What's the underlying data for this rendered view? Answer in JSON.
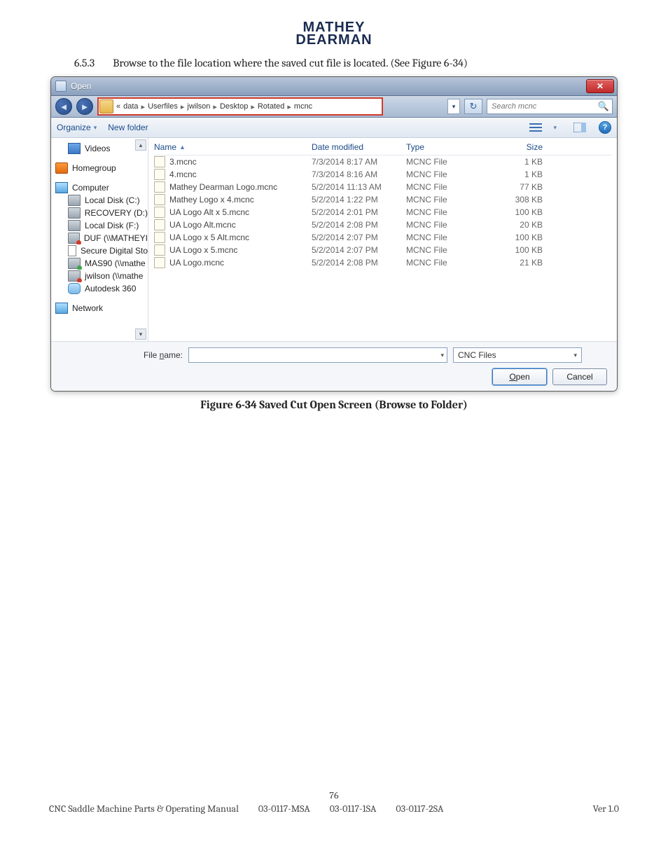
{
  "brand": {
    "line1": "MATHEY",
    "line2": "DEARMAN"
  },
  "instruction": {
    "num": "6.5.3",
    "text": "Browse to the file location where the saved cut file is located. (See Figure 6-34)"
  },
  "dialog": {
    "title": "Open",
    "close_glyph": "✕",
    "nav": {
      "back_glyph": "◄",
      "fwd_glyph": "►",
      "history_glyph": "▾",
      "refresh_glyph": "↻",
      "breadcrumb_prefix": "«",
      "breadcrumb": [
        "data",
        "Userfiles",
        "jwilson",
        "Desktop",
        "Rotated",
        "mcnc"
      ],
      "search_placeholder": "Search mcnc",
      "search_glyph": "🔍"
    },
    "toolbar": {
      "organize": "Organize",
      "newfolder": "New folder",
      "dd_glyph": "▾",
      "help_glyph": "?"
    },
    "navpane": {
      "videos": "Videos",
      "homegroup": "Homegroup",
      "computer": "Computer",
      "drives": [
        {
          "label": "Local Disk (C:)",
          "icon": "ic-drive"
        },
        {
          "label": "RECOVERY (D:)",
          "icon": "ic-drive"
        },
        {
          "label": "Local Disk (F:)",
          "icon": "ic-drive"
        },
        {
          "label": "DUF (\\\\MATHEYI",
          "icon": "ic-netdr dis"
        },
        {
          "label": "Secure Digital Sto",
          "icon": "ic-card"
        },
        {
          "label": "MAS90 (\\\\mathe",
          "icon": "ic-netdr"
        },
        {
          "label": "jwilson (\\\\mathe",
          "icon": "ic-netdr dis"
        },
        {
          "label": "Autodesk 360",
          "icon": "ic-cloud"
        }
      ],
      "network": "Network"
    },
    "columns": {
      "name": "Name",
      "date": "Date modified",
      "type": "Type",
      "size": "Size",
      "sort_glyph": "▲"
    },
    "files": [
      {
        "name": "3.mcnc",
        "date": "7/3/2014 8:17 AM",
        "type": "MCNC File",
        "size": "1 KB"
      },
      {
        "name": "4.mcnc",
        "date": "7/3/2014 8:16 AM",
        "type": "MCNC File",
        "size": "1 KB"
      },
      {
        "name": "Mathey Dearman Logo.mcnc",
        "date": "5/2/2014 11:13 AM",
        "type": "MCNC File",
        "size": "77 KB"
      },
      {
        "name": "Mathey Logo x 4.mcnc",
        "date": "5/2/2014 1:22 PM",
        "type": "MCNC File",
        "size": "308 KB"
      },
      {
        "name": "UA Logo Alt x 5.mcnc",
        "date": "5/2/2014 2:01 PM",
        "type": "MCNC File",
        "size": "100 KB"
      },
      {
        "name": "UA Logo Alt.mcnc",
        "date": "5/2/2014 2:08 PM",
        "type": "MCNC File",
        "size": "20 KB"
      },
      {
        "name": "UA Logo x 5 Alt.mcnc",
        "date": "5/2/2014 2:07 PM",
        "type": "MCNC File",
        "size": "100 KB"
      },
      {
        "name": "UA Logo x 5.mcnc",
        "date": "5/2/2014 2:07 PM",
        "type": "MCNC File",
        "size": "100 KB"
      },
      {
        "name": "UA Logo.mcnc",
        "date": "5/2/2014 2:08 PM",
        "type": "MCNC File",
        "size": "21 KB"
      }
    ],
    "footer": {
      "filename_label_pre": "File ",
      "filename_label_ul": "n",
      "filename_label_post": "ame:",
      "filter": "CNC Files",
      "open_ul": "O",
      "open_rest": "pen",
      "cancel": "Cancel",
      "dd_glyph": "▾"
    }
  },
  "caption": "Figure 6-34 Saved Cut Open Screen (Browse to Folder)",
  "pagefoot": {
    "num": "76",
    "left": "CNC Saddle Machine Parts & Operating Manual",
    "c1": "03-0117-MSA",
    "c2": "03-0117-1SA",
    "c3": "03-0117-2SA",
    "ver": "Ver 1.0"
  }
}
